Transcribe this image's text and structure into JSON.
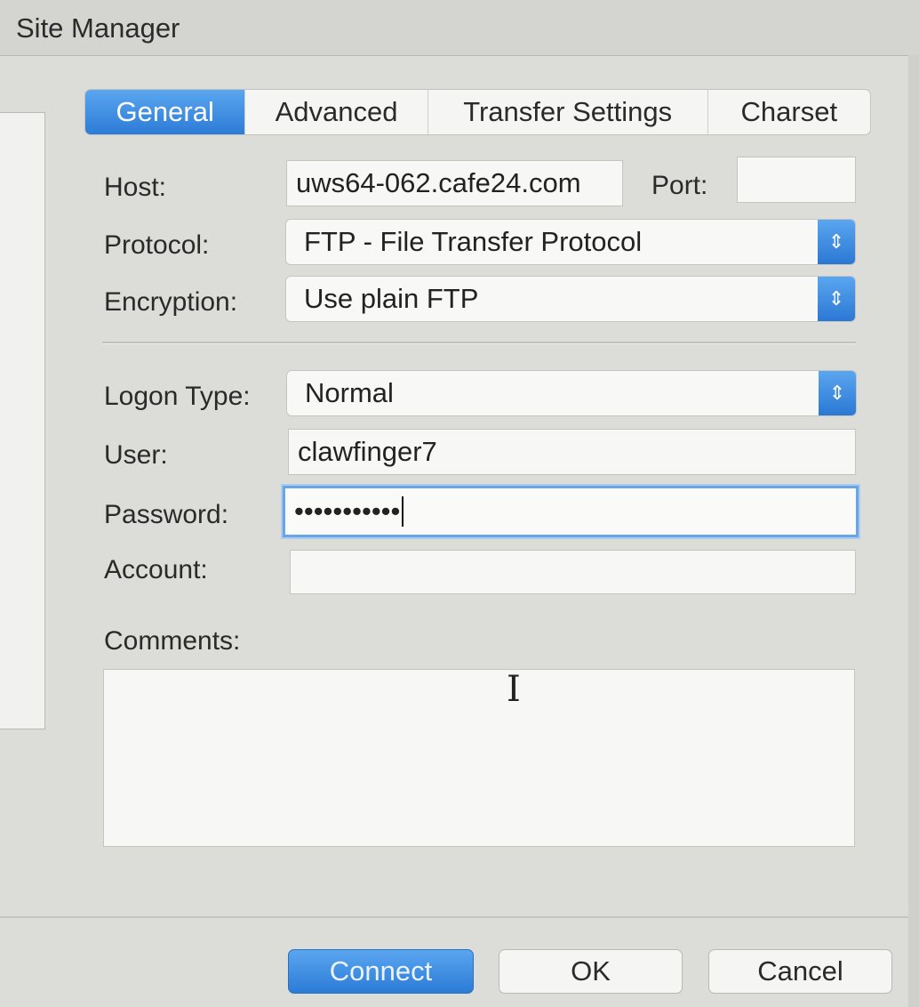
{
  "window": {
    "title": "Site Manager"
  },
  "tabs": [
    {
      "label": "General",
      "active": true
    },
    {
      "label": "Advanced",
      "active": false
    },
    {
      "label": "Transfer Settings",
      "active": false
    },
    {
      "label": "Charset",
      "active": false
    }
  ],
  "form": {
    "host": {
      "label": "Host:",
      "value": "uws64-062.cafe24.com"
    },
    "port": {
      "label": "Port:",
      "value": ""
    },
    "protocol": {
      "label": "Protocol:",
      "value": "FTP - File Transfer Protocol"
    },
    "encryption": {
      "label": "Encryption:",
      "value": "Use plain FTP"
    },
    "logon_type": {
      "label": "Logon Type:",
      "value": "Normal"
    },
    "user": {
      "label": "User:",
      "value": "clawfinger7"
    },
    "password": {
      "label": "Password:",
      "value": "•••••••••••"
    },
    "account": {
      "label": "Account:",
      "value": ""
    },
    "comments": {
      "label": "Comments:",
      "value": ""
    }
  },
  "buttons": {
    "connect": "Connect",
    "ok": "OK",
    "cancel": "Cancel"
  },
  "colors": {
    "accent": "#2c7bd6",
    "background": "#dcdcd8"
  }
}
